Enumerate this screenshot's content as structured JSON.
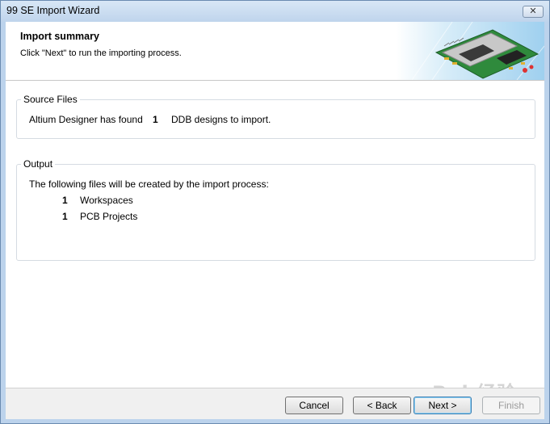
{
  "window": {
    "title": "99 SE Import Wizard",
    "close_glyph": "✕"
  },
  "header": {
    "title": "Import summary",
    "subtitle": "Click \"Next\" to run the importing process."
  },
  "source_files": {
    "legend": "Source Files",
    "prefix": "Altium Designer has found",
    "count": "1",
    "suffix": "DDB designs to import."
  },
  "output": {
    "legend": "Output",
    "intro": "The following files will be created by the import process:",
    "items": [
      {
        "count": "1",
        "label": "Workspaces"
      },
      {
        "count": "1",
        "label": "PCB Projects"
      }
    ]
  },
  "buttons": {
    "cancel": "Cancel",
    "back": "< Back",
    "next": "Next >",
    "finish": "Finish"
  },
  "watermark": "Bai 经验",
  "colors": {
    "titlebar": "#bfd4ec",
    "default_button_border": "#3c7fb1"
  }
}
